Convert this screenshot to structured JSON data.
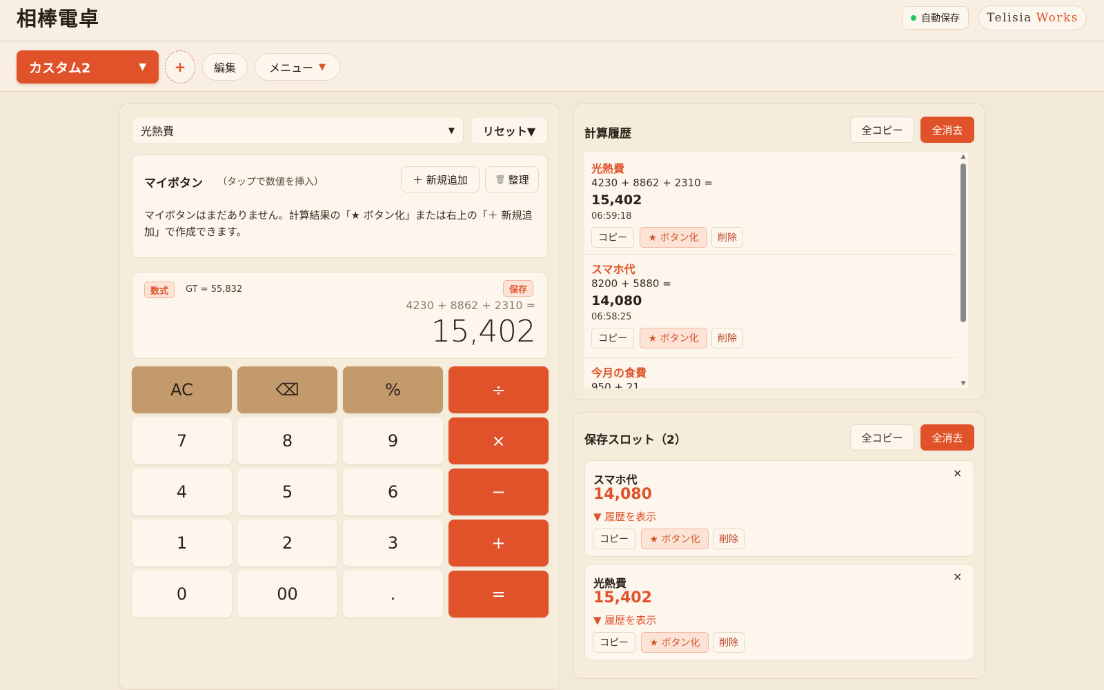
{
  "app": {
    "title": "相棒電卓",
    "autosave_label": "自動保存",
    "brand_part1": "Telisia",
    "brand_part2": "Works"
  },
  "toolbar": {
    "preset_label": "カスタム2",
    "preset_caret": "▼",
    "add_label": "+",
    "edit_label": "編集",
    "menu_label": "メニュー",
    "menu_caret": "▼"
  },
  "calculator": {
    "memo_select": "光熱費",
    "memo_caret": "▼",
    "reset_label": "リセット▼",
    "my_buttons": {
      "title": "マイボタン",
      "hint": "（タップで数値を挿入）",
      "add_label": "＋ 新規追加",
      "organize_icon": "🗑",
      "organize_label": "整理",
      "empty_message": "マイボタンはまだありません。計算結果の「★ ボタン化」または右上の「＋ 新規追加」で作成できます。"
    },
    "display": {
      "mode_tag": "数式",
      "grand_total": "GT = 55,832",
      "save_tag": "保存",
      "expression": "4230 + 8862 + 2310 =",
      "result": "15,402"
    },
    "keys": [
      {
        "label": "AC",
        "kind": "fn"
      },
      {
        "label": "⌫",
        "kind": "fn"
      },
      {
        "label": "%",
        "kind": "fn"
      },
      {
        "label": "÷",
        "kind": "op"
      },
      {
        "label": "7",
        "kind": "num"
      },
      {
        "label": "8",
        "kind": "num"
      },
      {
        "label": "9",
        "kind": "num"
      },
      {
        "label": "×",
        "kind": "op"
      },
      {
        "label": "4",
        "kind": "num"
      },
      {
        "label": "5",
        "kind": "num"
      },
      {
        "label": "6",
        "kind": "num"
      },
      {
        "label": "−",
        "kind": "op"
      },
      {
        "label": "1",
        "kind": "num"
      },
      {
        "label": "2",
        "kind": "num"
      },
      {
        "label": "3",
        "kind": "num"
      },
      {
        "label": "+",
        "kind": "op"
      },
      {
        "label": "0",
        "kind": "num"
      },
      {
        "label": "00",
        "kind": "num"
      },
      {
        "label": ".",
        "kind": "num"
      },
      {
        "label": "=",
        "kind": "op"
      }
    ]
  },
  "history": {
    "title": "計算履歴",
    "copy_all": "全コピー",
    "clear_all": "全消去",
    "entries": [
      {
        "name": "光熱費",
        "expr": "4230 + 8862 + 2310 =",
        "value": "15,402",
        "time": "06:59:18"
      },
      {
        "name": "スマホ代",
        "expr": "8200 + 5880 =",
        "value": "14,080",
        "time": "06:58:25"
      },
      {
        "name": "今月の食費",
        "expr": "950 + 21",
        "value": "",
        "time": ""
      }
    ],
    "actions": {
      "copy": "コピー",
      "star": "★ ボタン化",
      "delete": "削除"
    }
  },
  "slots": {
    "title": "保存スロット（2）",
    "copy_all": "全コピー",
    "clear_all": "全消去",
    "show_history": "▼ 履歴を表示",
    "close": "×",
    "items": [
      {
        "name": "スマホ代",
        "value": "14,080"
      },
      {
        "name": "光熱費",
        "value": "15,402"
      }
    ],
    "actions": {
      "copy": "コピー",
      "star": "★ ボタン化",
      "delete": "削除"
    }
  },
  "colors": {
    "accent": "#e0532a",
    "background": "#f3e9d9",
    "function_key": "#c39a6c",
    "status_green": "#22c55e"
  }
}
